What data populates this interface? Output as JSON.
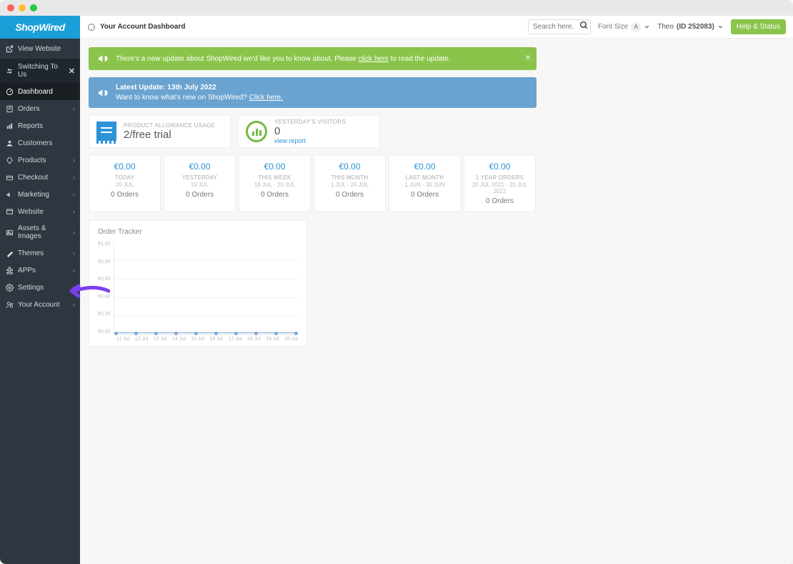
{
  "brand": {
    "name": "ShopWired"
  },
  "header": {
    "page_title": "Your Account Dashboard",
    "search_placeholder": "Search here...",
    "font_size_label": "Font Size",
    "font_size_badge": "A",
    "user_name": "Theo",
    "user_id_label": "(ID 252083)",
    "help_button": "Help & Status"
  },
  "sidebar": {
    "view_website": "View Website",
    "switching": "Switching To Us",
    "items": [
      {
        "label": "Dashboard",
        "icon": "dashboard",
        "expand": false,
        "active": true
      },
      {
        "label": "Orders",
        "icon": "orders",
        "expand": true
      },
      {
        "label": "Reports",
        "icon": "reports",
        "expand": false
      },
      {
        "label": "Customers",
        "icon": "customers",
        "expand": false
      },
      {
        "label": "Products",
        "icon": "products",
        "expand": true
      },
      {
        "label": "Checkout",
        "icon": "checkout",
        "expand": true
      },
      {
        "label": "Marketing",
        "icon": "marketing",
        "expand": true
      },
      {
        "label": "Website",
        "icon": "website",
        "expand": true
      },
      {
        "label": "Assets & Images",
        "icon": "assets",
        "expand": true
      },
      {
        "label": "Themes",
        "icon": "themes",
        "expand": true
      },
      {
        "label": "APPs",
        "icon": "apps",
        "expand": true
      },
      {
        "label": "Settings",
        "icon": "settings",
        "expand": true
      },
      {
        "label": "Your Account",
        "icon": "account",
        "expand": true
      }
    ]
  },
  "banners": {
    "update": {
      "prefix": "There's a new update about ShopWired we'd like you to know about. Please ",
      "link": "click here",
      "suffix": " to read the update."
    },
    "latest": {
      "line1": "Latest Update: 13th July 2022",
      "line2_prefix": "Want to know what's new on ShopWired? ",
      "line2_link": "Click here."
    }
  },
  "cards": {
    "allowance": {
      "label": "PRODUCT ALLOWANCE USAGE",
      "value": "2/free trial"
    },
    "visitors": {
      "label": "YESTERDAY'S VISITORS",
      "value": "0",
      "link": "view report"
    }
  },
  "stats": [
    {
      "amount": "€0.00",
      "label": "TODAY",
      "range": "20 JUL",
      "orders": "0 Orders"
    },
    {
      "amount": "€0.00",
      "label": "YESTERDAY",
      "range": "19 JUL",
      "orders": "0 Orders"
    },
    {
      "amount": "€0.00",
      "label": "THIS WEEK",
      "range": "18 JUL - 20 JUL",
      "orders": "0 Orders"
    },
    {
      "amount": "€0.00",
      "label": "THIS MONTH",
      "range": "1 JUL - 20 JUL",
      "orders": "0 Orders"
    },
    {
      "amount": "€0.00",
      "label": "LAST MONTH",
      "range": "1 JUN - 30 JUN",
      "orders": "0 Orders"
    },
    {
      "amount": "€0.00",
      "label": "1 YEAR ORDERS",
      "range": "20 JUL 2021 - 20 JUL 2022",
      "orders": "0 Orders"
    }
  ],
  "chart": {
    "title": "Order Tracker"
  },
  "chart_data": {
    "type": "line",
    "title": "Order Tracker",
    "xlabel": "",
    "ylabel": "",
    "ylim": [
      0,
      1.0
    ],
    "y_ticks": [
      "€1.00",
      "€0.80",
      "€0.60",
      "€0.40",
      "€0.20",
      "€0.00"
    ],
    "categories": [
      "11 Jul",
      "12 Jul",
      "13 Jul",
      "14 Jul",
      "15 Jul",
      "16 Jul",
      "17 Jul",
      "18 Jul",
      "19 Jul",
      "20 Jul"
    ],
    "values": [
      0,
      0,
      0,
      0,
      0,
      0,
      0,
      0,
      0,
      0
    ]
  }
}
